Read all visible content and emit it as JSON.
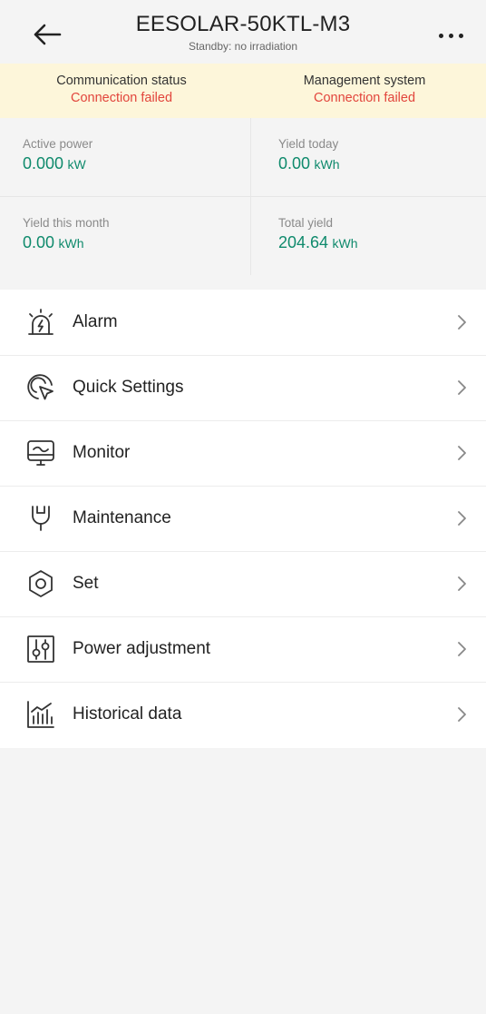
{
  "header": {
    "title": "EESOLAR-50KTL-M3",
    "subtitle": "Standby: no irradiation"
  },
  "status": {
    "communication_label": "Communication status",
    "communication_value": "Connection failed",
    "management_label": "Management system",
    "management_value": "Connection failed"
  },
  "metrics": {
    "active_power": {
      "label": "Active power",
      "value": "0.000",
      "unit": "kW"
    },
    "yield_today": {
      "label": "Yield today",
      "value": "0.00",
      "unit": "kWh"
    },
    "yield_month": {
      "label": "Yield this month",
      "value": "0.00",
      "unit": "kWh"
    },
    "total_yield": {
      "label": "Total yield",
      "value": "204.64",
      "unit": "kWh"
    }
  },
  "menu": {
    "items": [
      {
        "label": "Alarm",
        "icon": "alarm-icon"
      },
      {
        "label": "Quick Settings",
        "icon": "quick-settings-icon"
      },
      {
        "label": "Monitor",
        "icon": "monitor-icon"
      },
      {
        "label": "Maintenance",
        "icon": "maintenance-icon"
      },
      {
        "label": "Set",
        "icon": "settings-hexagon-icon"
      },
      {
        "label": "Power adjustment",
        "icon": "power-adjustment-icon"
      },
      {
        "label": "Historical data",
        "icon": "historical-data-icon"
      }
    ]
  },
  "colors": {
    "accent_green": "#0f8a6c",
    "error_red": "#e2453c",
    "banner_bg": "#fdf6da",
    "page_bg": "#f4f4f4"
  }
}
